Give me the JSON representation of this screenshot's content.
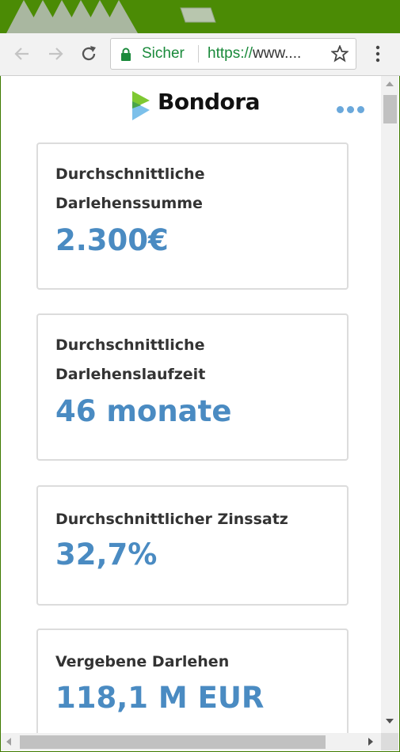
{
  "browser": {
    "secure_label": "Sicher",
    "url_scheme": "https://",
    "url_rest": "www....",
    "colors": {
      "frame": "#4b8b05",
      "secure": "#1a8a3b"
    }
  },
  "header": {
    "logo_text": "Bondora"
  },
  "stats": [
    {
      "label_line1": "Durchschnittliche",
      "label_line2": "Darlehenssumme",
      "value": "2.300€"
    },
    {
      "label_line1": "Durchschnittliche",
      "label_line2": "Darlehenslaufzeit",
      "value": "46 monate"
    },
    {
      "label_line1": "Durchschnittlicher Zinssatz",
      "label_line2": "",
      "value": "32,7%"
    },
    {
      "label_line1": "Vergebene Darlehen",
      "label_line2": "",
      "value": "118,1 M EUR"
    }
  ],
  "accent_color": "#4a8bc2",
  "icons": {
    "back": "arrow-left-icon",
    "forward": "arrow-right-icon",
    "reload": "reload-icon",
    "lock": "lock-icon",
    "star": "star-icon",
    "browser_menu": "vertical-dots-icon",
    "page_menu": "horizontal-dots-icon"
  }
}
